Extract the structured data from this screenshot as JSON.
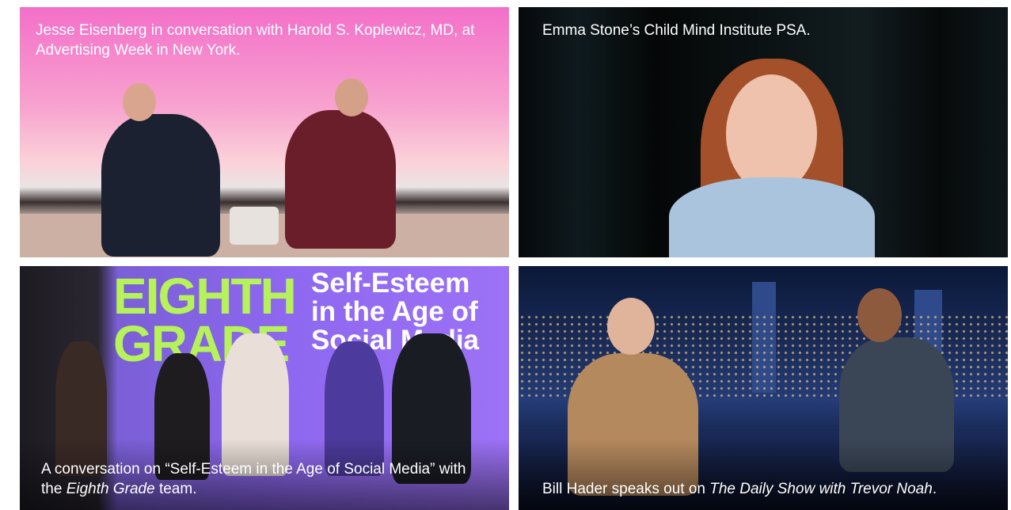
{
  "tiles": [
    {
      "caption": "Jesse Eisenberg in conversation with Harold S. Koplewicz, MD, at Advertising Week in New York."
    },
    {
      "caption": "Emma Stone’s Child Mind Institute PSA."
    },
    {
      "caption_part1": "A conversation on “Self-Esteem in the Age of Social Media” with the ",
      "caption_em": "Eighth Grade",
      "caption_part2": " team.",
      "screen_title": "Self-Esteem in the Age of Social Media",
      "screen_film": "EIGHTH GRADE"
    },
    {
      "caption_part1": "Bill Hader speaks out on ",
      "caption_em": "The Daily Show with Trevor Noah",
      "caption_part2": "."
    }
  ]
}
